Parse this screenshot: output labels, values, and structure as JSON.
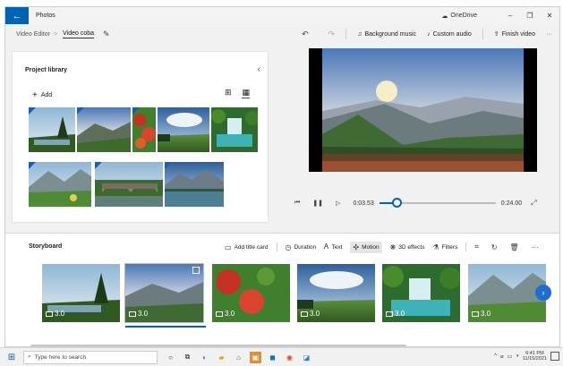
{
  "window": {
    "app_title": "Photos",
    "onedrive_label": "OneDrive"
  },
  "toolbar": {
    "breadcrumb_root": "Video Editor",
    "breadcrumb_separator": ">",
    "project_name": "Video coba",
    "background_music_label": "Background music",
    "custom_audio_label": "Custom audio",
    "finish_video_label": "Finish video"
  },
  "library": {
    "title": "Project library",
    "add_label": "Add",
    "thumbnails": [
      "forest pagoda lake",
      "mountain valley",
      "red flower field",
      "lakeside forest under sky",
      "waterfall pool",
      "snowy mountain meadow",
      "stone arch bridge",
      "alpine lake"
    ]
  },
  "player": {
    "current_time": "0:03.53",
    "total_time": "0:24.00",
    "progress": 0.15
  },
  "storyboard": {
    "title": "Storyboard",
    "add_title_card": "Add title card",
    "duration": "Duration",
    "text": "Text",
    "motion": "Motion",
    "effects_3d": "3D effects",
    "filters": "Filters",
    "clips": [
      {
        "duration": "3.0"
      },
      {
        "duration": "3.0"
      },
      {
        "duration": "3.0"
      },
      {
        "duration": "3.0"
      },
      {
        "duration": "3.0"
      },
      {
        "duration": "3.0"
      }
    ]
  },
  "taskbar": {
    "search_placeholder": "Type here to search",
    "time": "6:41 PM",
    "date": "11/15/2021"
  },
  "colors": {
    "accent": "#0063b1"
  }
}
